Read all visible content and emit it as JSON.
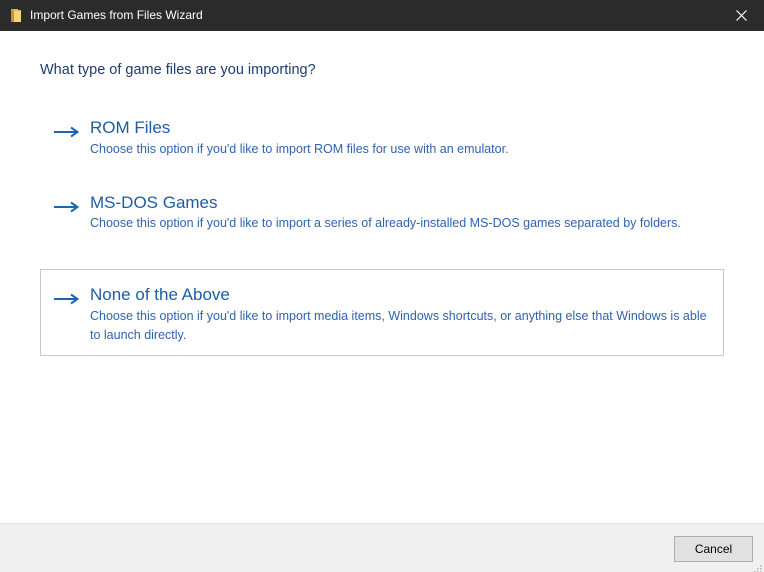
{
  "window": {
    "title": "Import Games from Files Wizard",
    "app_icon": "folder-icon",
    "close_icon": "close-icon"
  },
  "question": "What type of game files are you importing?",
  "options": [
    {
      "title": "ROM Files",
      "description": "Choose this option if you'd like to import ROM files for use with an emulator.",
      "icon": "arrow-right-icon",
      "selected": false
    },
    {
      "title": "MS-DOS Games",
      "description": "Choose this option if you'd like to import a series of already-installed MS-DOS games separated by folders.",
      "icon": "arrow-right-icon",
      "selected": false
    },
    {
      "title": "None of the Above",
      "description": "Choose this option if you'd like to import media items, Windows shortcuts, or anything else that Windows is able to launch directly.",
      "icon": "arrow-right-icon",
      "selected": true
    }
  ],
  "footer": {
    "cancel_label": "Cancel"
  },
  "colors": {
    "titlebar": "#2b2b2b",
    "heading": "#1d3b75",
    "link": "#1d5da8",
    "arrow": "#1d64b3",
    "footer": "#f0f0f0"
  }
}
